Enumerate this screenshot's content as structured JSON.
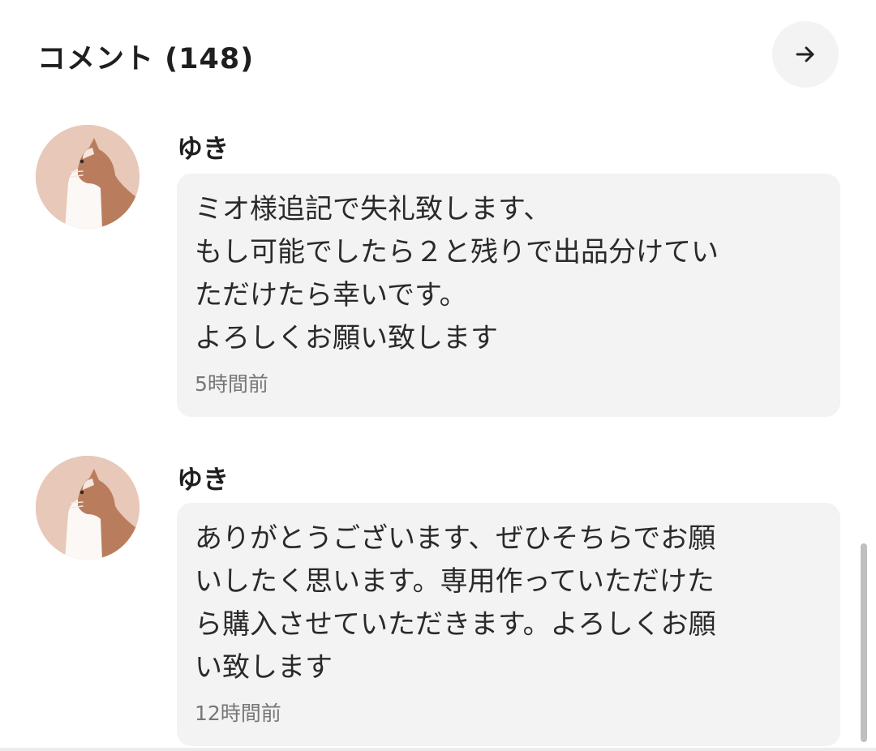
{
  "header": {
    "title": "コメント (148)",
    "next_icon": "arrow-right-icon"
  },
  "comments": [
    {
      "username": "ゆき",
      "avatar_icon": "cat-avatar-icon",
      "message": "ミオ様追記で失礼致します、\nもし可能でしたら２と残りで出品分けてい\nただけたら幸いです。\nよろしくお願い致します",
      "timestamp": "5時間前"
    },
    {
      "username": "ゆき",
      "avatar_icon": "cat-avatar-icon",
      "message": "ありがとうございます、ぜひそちらでお願\nいしたく思います。専用作っていただけた\nら購入させていただきます。よろしくお願\nい致します",
      "timestamp": "12時間前"
    }
  ],
  "colors": {
    "bubble_background": "#f3f3f3",
    "text": "#2a2a2a",
    "muted_text": "#777777",
    "avatar_background": "#e8c8b8"
  }
}
